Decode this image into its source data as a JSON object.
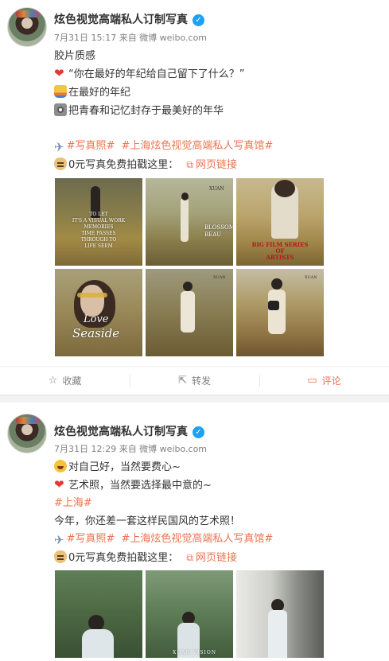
{
  "posts": [
    {
      "author": "炫色视觉高端私人订制写真",
      "meta": "7月31日 15:17 来自 微博 weibo.com",
      "lines": [
        "胶片质感",
        "“你在最好的年纪给自己留下了什么？”",
        "在最好的年纪",
        "把青春和记忆封存于最美好的年华"
      ],
      "tags": [
        "#写真照#",
        "#上海炫色视觉高端私人写真馆#"
      ],
      "promo": "0元写真免费拍戳这里：",
      "link_label": "网页链接",
      "photo_captions": {
        "p1": "TO LET\nIT'S A VISUAL WORK\nMEMORIES\nTIME PASSES\nTHROUGH TO\nLIFE SEEM",
        "p2": "BLOSSOM\nBEAU",
        "p2b": "XUAN",
        "p3": "BIG FILM SERIES\nOF\nARTISTS",
        "p4a": "Love",
        "p4b": "Seaside",
        "p5": "XUAN",
        "p6": "XUAN"
      },
      "actions": {
        "collect": "收藏",
        "repost": "转发",
        "comment": "评论"
      }
    },
    {
      "author": "炫色视觉高端私人订制写真",
      "meta": "7月31日 12:29 来自 微博 weibo.com",
      "lines": [
        "对自己好，当然要费心~",
        "艺术照，当然要选择最中意的~",
        "#上海#",
        "今年，你还差一套这样民国风的艺术照！"
      ],
      "tags": [
        "#写真照#",
        "#上海炫色视觉高端私人写真馆#"
      ],
      "promo": "0元写真免费拍戳这里：",
      "link_label": "网页链接",
      "photo_captions": {
        "p2": "XUAN VISION"
      }
    }
  ],
  "icons": {
    "collect": "star-outline-icon",
    "repost": "share-icon",
    "comment": "comment-icon",
    "link": "link-icon",
    "verified": "verified-badge-icon"
  },
  "colors": {
    "accent": "#eb7350",
    "verified": "#1da1f2",
    "meta": "#808080"
  }
}
